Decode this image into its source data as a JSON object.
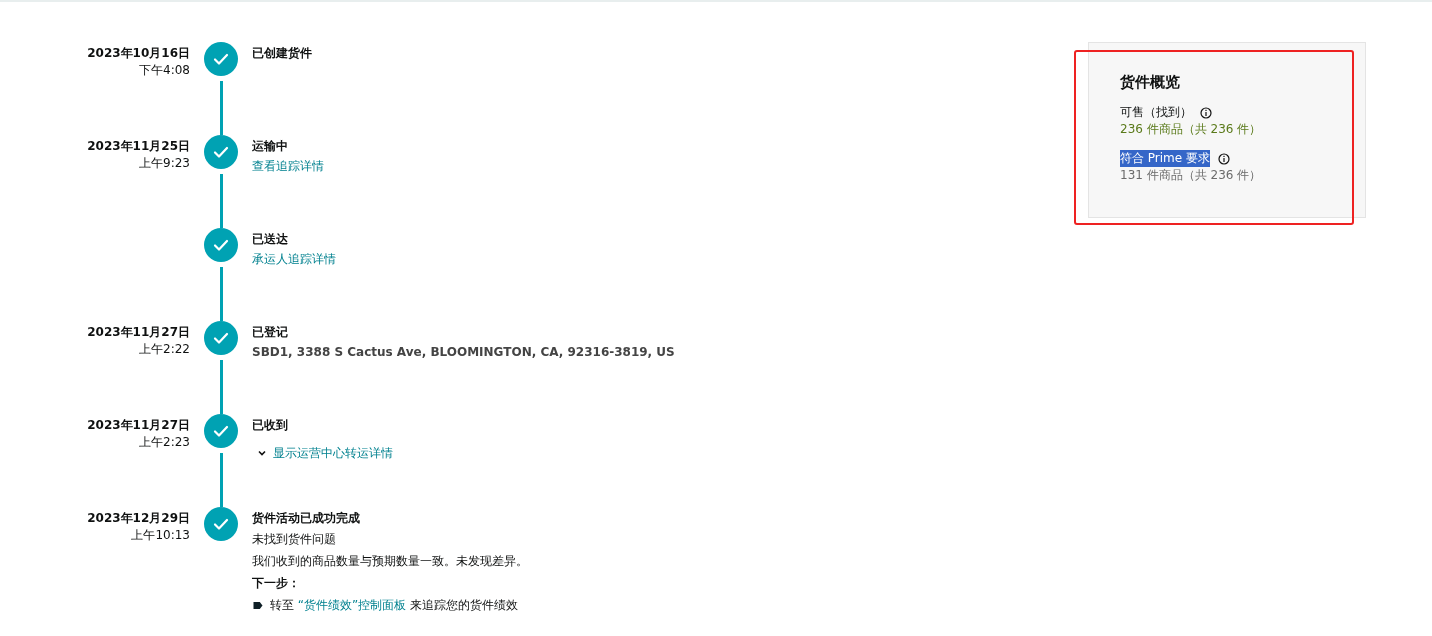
{
  "timeline": [
    {
      "date": "2023年10月16日",
      "time": "下午4:08",
      "title": "已创建货件",
      "done": true
    },
    {
      "date": "2023年11月25日",
      "time": "上午9:23",
      "title": "运输中",
      "done": true,
      "details": [
        {
          "kind": "link",
          "text": "查看追踪详情"
        }
      ]
    },
    {
      "title": "已送达",
      "done": true,
      "details": [
        {
          "kind": "link",
          "text": "承运人追踪详情"
        }
      ]
    },
    {
      "date": "2023年11月27日",
      "time": "上午2:22",
      "title": "已登记",
      "done": true,
      "details": [
        {
          "kind": "address",
          "text": "SBD1, 3388 S Cactus Ave, BLOOMINGTON, CA, 92316-3819, US"
        }
      ]
    },
    {
      "date": "2023年11月27日",
      "time": "上午2:23",
      "title": "已收到",
      "done": true,
      "details": [
        {
          "kind": "toggle",
          "text": "显示运营中心转运详情",
          "expanded": false
        }
      ]
    },
    {
      "date": "2023年12月29日",
      "time": "上午10:13",
      "title": "货件活动已成功完成",
      "done": true,
      "details": [
        {
          "kind": "text",
          "text": "未找到货件问题"
        },
        {
          "kind": "text",
          "text": "我们收到的商品数量与预期数量一致。未发现差异。"
        },
        {
          "kind": "heading",
          "text": "下一步："
        },
        {
          "kind": "bullet",
          "before": "转至 ",
          "link": "“货件绩效”控制面板",
          "after": " 来追踪您的货件绩效"
        }
      ]
    }
  ],
  "overview": {
    "title": "货件概览",
    "outlined": true,
    "metrics": [
      {
        "label": "可售（找到）",
        "value": "236 件商品（共 236 件）",
        "color": "#5a7a1a",
        "highlighted": false
      },
      {
        "label": "符合 Prime 要求",
        "value": "131 件商品（共 236 件）",
        "color": "#6b6b6b",
        "highlighted": true
      }
    ]
  }
}
